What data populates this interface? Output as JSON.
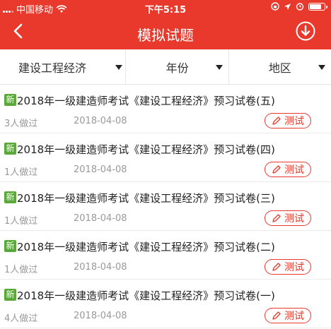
{
  "status_bar": {
    "carrier": "中国移动",
    "time": "下午5:15"
  },
  "header": {
    "title": "模拟试题"
  },
  "filters": [
    {
      "label": "建设工程经济"
    },
    {
      "label": "年份"
    },
    {
      "label": "地区"
    }
  ],
  "items": [
    {
      "badge": "新",
      "title": "2018年一级建造师考试《建设工程经济》预习试卷(五)",
      "count": "3人做过",
      "date": "2018-04-08",
      "action": "测试"
    },
    {
      "badge": "新",
      "title": "2018年一级建造师考试《建设工程经济》预习试卷(四)",
      "count": "1人做过",
      "date": "2018-04-08",
      "action": "测试"
    },
    {
      "badge": "新",
      "title": "2018年一级建造师考试《建设工程经济》预习试卷(三)",
      "count": "1人做过",
      "date": "2018-04-08",
      "action": "测试"
    },
    {
      "badge": "新",
      "title": "2018年一级建造师考试《建设工程经济》预习试卷(二)",
      "count": "1人做过",
      "date": "2018-04-08",
      "action": "测试"
    },
    {
      "badge": "新",
      "title": "2018年一级建造师考试《建设工程经济》预习试卷(一)",
      "count": "4人做过",
      "date": "2018-04-08",
      "action": "测试"
    }
  ]
}
